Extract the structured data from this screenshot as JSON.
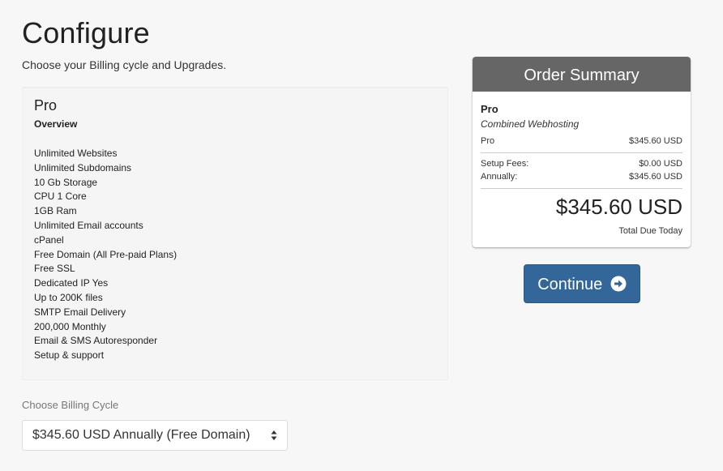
{
  "page": {
    "title": "Configure",
    "subtitle": "Choose your Billing cycle and Upgrades."
  },
  "product": {
    "name": "Pro",
    "overview_label": "Overview",
    "features": [
      "Unlimited Websites",
      "Unlimited Subdomains",
      "10 Gb Storage",
      "CPU 1 Core",
      "1GB Ram",
      "Unlimited Email accounts",
      "cPanel",
      "Free Domain (All Pre-paid Plans)",
      "Free SSL",
      "Dedicated IP Yes",
      "Up to 200K files",
      "SMTP Email Delivery",
      "200,000 Monthly",
      "Email & SMS Autoresponder",
      "Setup & support"
    ]
  },
  "billing": {
    "label": "Choose Billing Cycle",
    "selected": "$345.60 USD Annually (Free Domain)",
    "arrow_icon": "sort-arrows-icon"
  },
  "summary": {
    "header": "Order Summary",
    "product": "Pro",
    "group": "Combined Webhosting",
    "line_item": {
      "label": "Pro",
      "value": "$345.60 USD"
    },
    "setup_fees": {
      "label": "Setup Fees:",
      "value": "$0.00 USD"
    },
    "annually": {
      "label": "Annually:",
      "value": "$345.60 USD"
    },
    "total": "$345.60 USD",
    "total_label": "Total Due Today"
  },
  "actions": {
    "continue_label": "Continue",
    "continue_icon": "arrow-circle-right-icon"
  },
  "colors": {
    "primary_button": "#336699",
    "summary_header": "#666666"
  }
}
